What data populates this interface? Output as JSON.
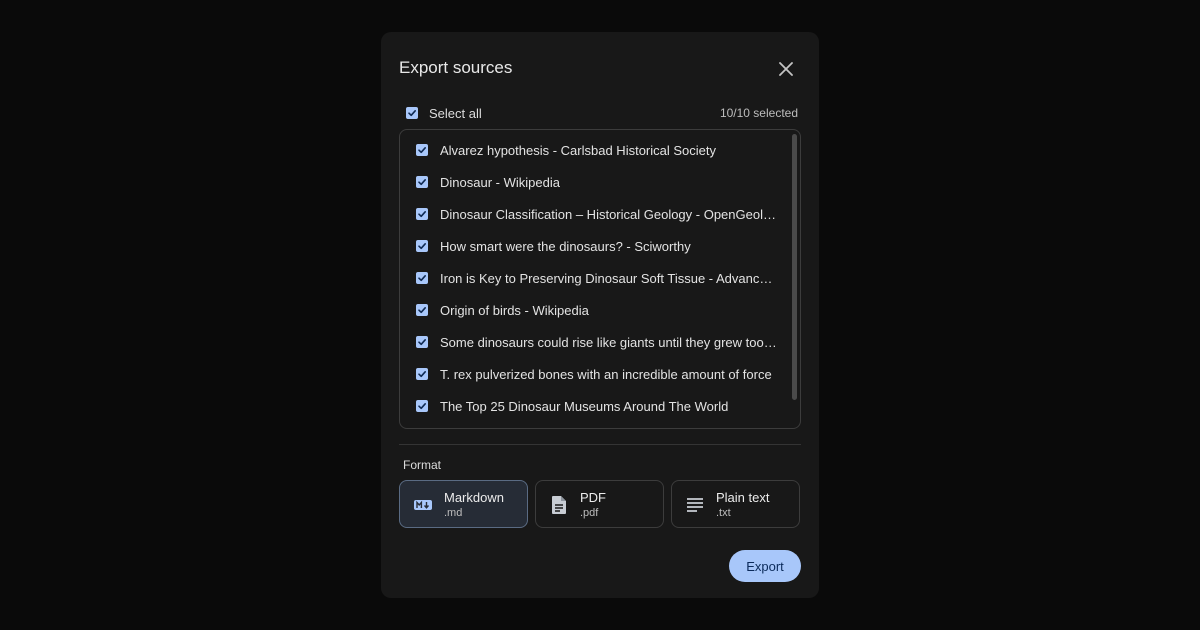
{
  "dialog": {
    "title": "Export sources",
    "close_icon": "close-icon"
  },
  "select_all": {
    "label": "Select all",
    "checked": true,
    "count": "10/10 selected"
  },
  "sources": [
    {
      "label": "Alvarez hypothesis - Carlsbad Historical Society",
      "checked": true
    },
    {
      "label": "Dinosaur - Wikipedia",
      "checked": true
    },
    {
      "label": "Dinosaur Classification – Historical Geology - OpenGeology",
      "checked": true
    },
    {
      "label": "How smart were the dinosaurs? - Sciworthy",
      "checked": true
    },
    {
      "label": "Iron is Key to Preserving Dinosaur Soft Tissue - Advanced Science News",
      "checked": true
    },
    {
      "label": "Origin of birds - Wikipedia",
      "checked": true
    },
    {
      "label": "Some dinosaurs could rise like giants until they grew too big",
      "checked": true
    },
    {
      "label": "T. rex pulverized bones with an incredible amount of force",
      "checked": true
    },
    {
      "label": "The Top 25 Dinosaur Museums Around The World",
      "checked": true
    }
  ],
  "format": {
    "label": "Format",
    "options": [
      {
        "name": "Markdown",
        "ext": ".md",
        "icon": "markdown-icon",
        "selected": true
      },
      {
        "name": "PDF",
        "ext": ".pdf",
        "icon": "document-icon",
        "selected": false
      },
      {
        "name": "Plain text",
        "ext": ".txt",
        "icon": "text-lines-icon",
        "selected": false
      }
    ]
  },
  "export_label": "Export",
  "colors": {
    "accent": "#a8c7fa",
    "dialog_bg": "#181818",
    "page_bg": "#0a0a0a"
  }
}
